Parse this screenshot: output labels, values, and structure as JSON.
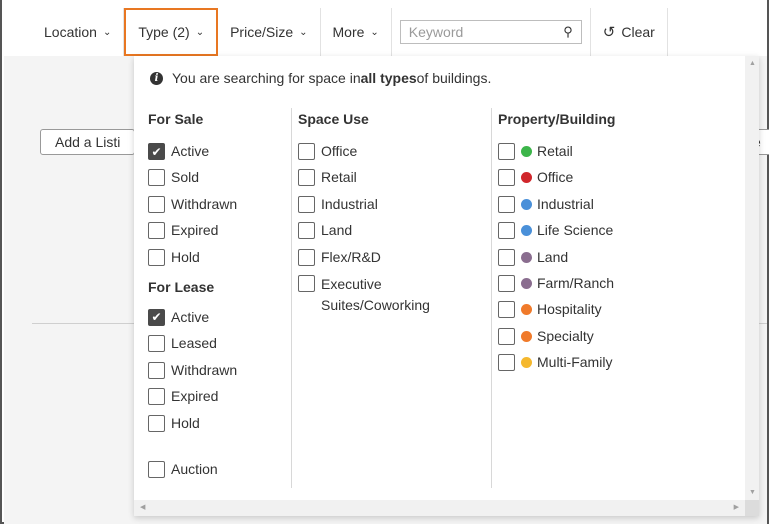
{
  "toolbar": {
    "location_label": "Location",
    "type_label": "Type (2)",
    "price_size_label": "Price/Size",
    "more_label": "More",
    "keyword_placeholder": "Keyword",
    "clear_label": "Clear"
  },
  "background": {
    "add_listing_label": "Add a Listi",
    "right_button_label": "e"
  },
  "dropdown": {
    "notice_prefix": "You are searching for space in ",
    "notice_bold": "all types",
    "notice_suffix": " of buildings.",
    "for_sale": {
      "heading": "For Sale",
      "options": [
        {
          "label": "Active",
          "checked": true
        },
        {
          "label": "Sold",
          "checked": false
        },
        {
          "label": "Withdrawn",
          "checked": false
        },
        {
          "label": "Expired",
          "checked": false
        },
        {
          "label": "Hold",
          "checked": false
        }
      ]
    },
    "for_lease": {
      "heading": "For Lease",
      "options": [
        {
          "label": "Active",
          "checked": true
        },
        {
          "label": "Leased",
          "checked": false
        },
        {
          "label": "Withdrawn",
          "checked": false
        },
        {
          "label": "Expired",
          "checked": false
        },
        {
          "label": "Hold",
          "checked": false
        }
      ]
    },
    "auction": {
      "label": "Auction",
      "checked": false
    },
    "space_use": {
      "heading": "Space Use",
      "options": [
        {
          "label": "Office",
          "checked": false
        },
        {
          "label": "Retail",
          "checked": false
        },
        {
          "label": "Industrial",
          "checked": false
        },
        {
          "label": "Land",
          "checked": false
        },
        {
          "label": "Flex/R&D",
          "checked": false
        },
        {
          "label": "Executive Suites/Coworking",
          "checked": false
        }
      ]
    },
    "property_building": {
      "heading": "Property/Building",
      "options": [
        {
          "label": "Retail",
          "color": "#3cb54a",
          "checked": false
        },
        {
          "label": "Office",
          "color": "#d0262b",
          "checked": false
        },
        {
          "label": "Industrial",
          "color": "#4a90d9",
          "checked": false
        },
        {
          "label": "Life Science",
          "color": "#4a90d9",
          "checked": false
        },
        {
          "label": "Land",
          "color": "#8a6d8f",
          "checked": false
        },
        {
          "label": "Farm/Ranch",
          "color": "#8a6d8f",
          "checked": false
        },
        {
          "label": "Hospitality",
          "color": "#f07a2a",
          "checked": false
        },
        {
          "label": "Specialty",
          "color": "#f07a2a",
          "checked": false
        },
        {
          "label": "Multi-Family",
          "color": "#f5b82e",
          "checked": false
        }
      ]
    }
  },
  "colors": {
    "type_highlight": "#e87722",
    "checked_box": "#4a4a4a"
  }
}
